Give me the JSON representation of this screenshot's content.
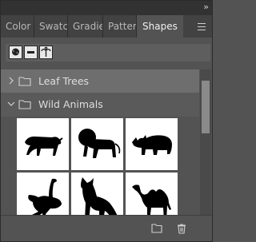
{
  "panel": {
    "tabs": [
      "Color",
      "Swatc",
      "Gradie",
      "Patter",
      "Shapes"
    ],
    "active_tab": "Shapes"
  },
  "topbar": {
    "collapse_glyph": "»"
  },
  "toolbar": {
    "icons": [
      "tree-shape-icon",
      "minus-shape-icon",
      "palm-tree-shape-icon"
    ]
  },
  "groups": [
    {
      "label": "Leaf Trees",
      "expanded": false
    },
    {
      "label": "Wild Animals",
      "expanded": true
    }
  ],
  "shapes": [
    "tiger",
    "lion",
    "rhinoceros",
    "ostrich",
    "wolf",
    "camel"
  ],
  "bottom": {
    "icons": [
      "new-group-folder-icon",
      "trash-icon"
    ]
  },
  "colors": {
    "panel_bg": "#535353",
    "tab_bar": "#424242",
    "highlight_row": "#6e6e6e",
    "text": "#dedede"
  }
}
